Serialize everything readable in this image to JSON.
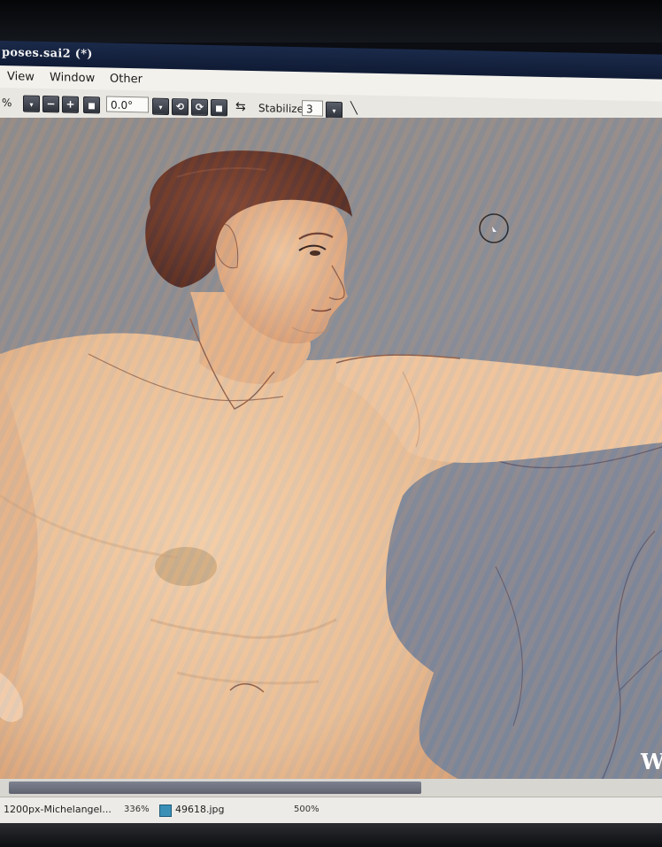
{
  "window": {
    "title": "poses.sai2 (*)"
  },
  "menu": {
    "items": [
      "View",
      "Window",
      "Other"
    ]
  },
  "toolbar": {
    "zoom_value": "%",
    "angle_value": "0.0°",
    "stabilizer_label": "Stabilizer",
    "stabilizer_value": "3"
  },
  "canvas": {
    "corner_text": "W"
  },
  "documents": [
    {
      "name": "1200px-Michelangel...",
      "zoom": "336%"
    },
    {
      "name": "49618.jpg",
      "zoom": "500%"
    }
  ],
  "icons": {
    "minus": "−",
    "plus": "+",
    "stop": "■",
    "rotate_left": "⟲",
    "rotate_right": "⟳",
    "flip": "⇆",
    "pen": "╲"
  },
  "colors": {
    "skin": "#efc9a2",
    "hair": "#5a2f22",
    "background": "#8a8c92"
  }
}
